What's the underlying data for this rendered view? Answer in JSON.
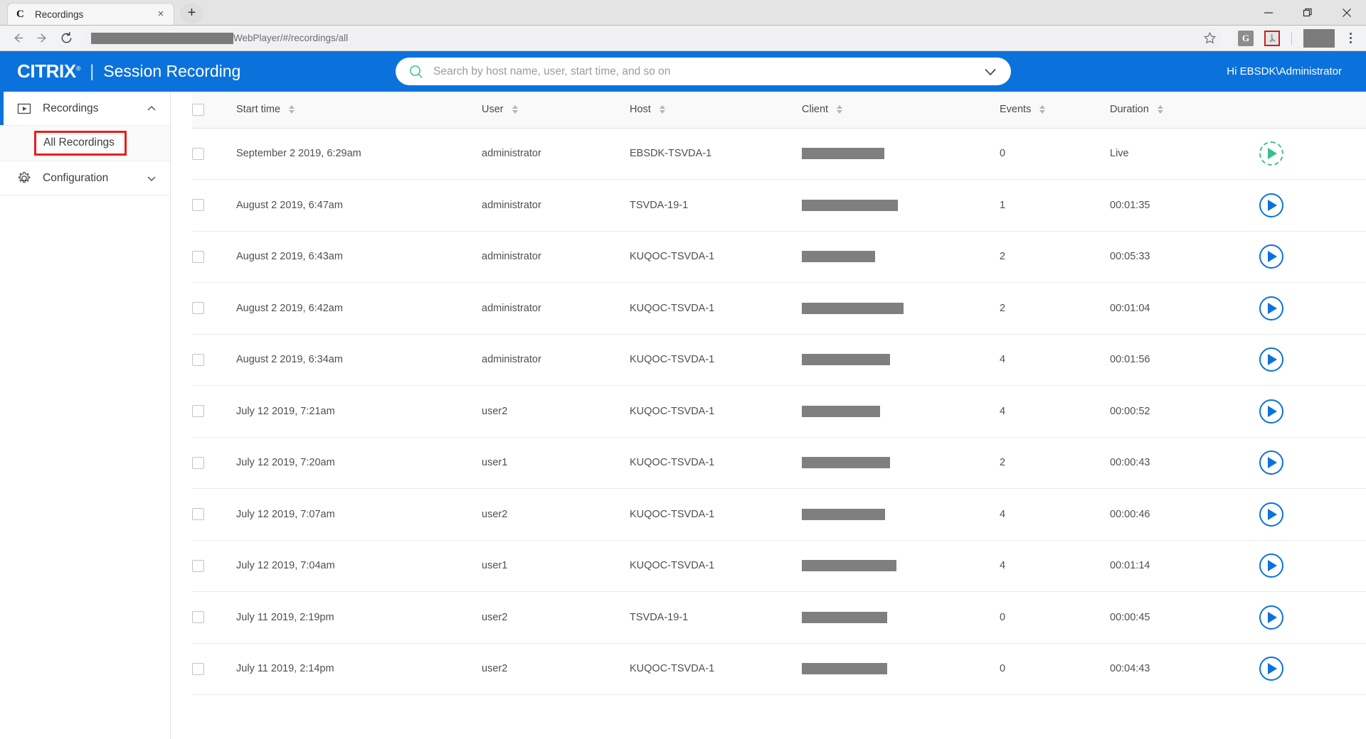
{
  "browser": {
    "tab": {
      "favicon": "C",
      "title": "Recordings",
      "close_label": "×"
    },
    "new_tab_label": "+",
    "window_controls": {
      "minimize": "minimize-icon",
      "maximize": "maximize-icon",
      "close": "close-icon"
    },
    "nav": {
      "back": "back-icon",
      "forward": "forward-icon",
      "reload": "reload-icon"
    },
    "url_text": "WebPlayer/#/recordings/all",
    "url_redacted": true,
    "toolbar_icons": [
      "star-icon",
      "google-extension-icon",
      "adobe-pdf-extension-icon",
      "profile-avatar",
      "browser-menu-icon"
    ],
    "extension_g_label": "G"
  },
  "header": {
    "brand": "CITRIX",
    "brand_trademark": "®",
    "separator": "|",
    "product": "Session Recording",
    "greeting": "Hi EBSDK\\Administrator",
    "accent_color": "#0b72dc"
  },
  "search": {
    "placeholder": "Search by host name, user, start time, and so on",
    "value": "",
    "icon": "search-icon",
    "chevron": "chevron-down-icon"
  },
  "sidebar": {
    "items": [
      {
        "label": "Recordings",
        "icon": "play-square-icon",
        "chevron": "chevron-up-icon",
        "expanded": true,
        "active": true
      },
      {
        "label": "Configuration",
        "icon": "gear-icon",
        "chevron": "chevron-down-icon",
        "expanded": false,
        "active": false
      }
    ],
    "sub_item": {
      "label": "All Recordings",
      "highlighted": true,
      "highlight_color": "#ee1c1c"
    }
  },
  "table": {
    "columns": [
      {
        "key": "start_time",
        "label": "Start time",
        "sortable": true
      },
      {
        "key": "user",
        "label": "User",
        "sortable": true
      },
      {
        "key": "host",
        "label": "Host",
        "sortable": true
      },
      {
        "key": "client",
        "label": "Client",
        "sortable": true
      },
      {
        "key": "events",
        "label": "Events",
        "sortable": true
      },
      {
        "key": "duration",
        "label": "Duration",
        "sortable": true
      }
    ],
    "rows": [
      {
        "start_time": "September 2 2019, 6:29am",
        "user": "administrator",
        "host": "EBSDK-TSVDA-1",
        "client_width": 116,
        "events": "0",
        "duration": "Live",
        "live": true
      },
      {
        "start_time": "August 2 2019, 6:47am",
        "user": "administrator",
        "host": "TSVDA-19-1",
        "client_width": 135,
        "events": "1",
        "duration": "00:01:35",
        "live": false
      },
      {
        "start_time": "August 2 2019, 6:43am",
        "user": "administrator",
        "host": "KUQOC-TSVDA-1",
        "client_width": 103,
        "events": "2",
        "duration": "00:05:33",
        "live": false
      },
      {
        "start_time": "August 2 2019, 6:42am",
        "user": "administrator",
        "host": "KUQOC-TSVDA-1",
        "client_width": 143,
        "events": "2",
        "duration": "00:01:04",
        "live": false
      },
      {
        "start_time": "August 2 2019, 6:34am",
        "user": "administrator",
        "host": "KUQOC-TSVDA-1",
        "client_width": 124,
        "events": "4",
        "duration": "00:01:56",
        "live": false
      },
      {
        "start_time": "July 12 2019, 7:21am",
        "user": "user2",
        "host": "KUQOC-TSVDA-1",
        "client_width": 110,
        "events": "4",
        "duration": "00:00:52",
        "live": false
      },
      {
        "start_time": "July 12 2019, 7:20am",
        "user": "user1",
        "host": "KUQOC-TSVDA-1",
        "client_width": 124,
        "events": "2",
        "duration": "00:00:43",
        "live": false
      },
      {
        "start_time": "July 12 2019, 7:07am",
        "user": "user2",
        "host": "KUQOC-TSVDA-1",
        "client_width": 117,
        "events": "4",
        "duration": "00:00:46",
        "live": false
      },
      {
        "start_time": "July 12 2019, 7:04am",
        "user": "user1",
        "host": "KUQOC-TSVDA-1",
        "client_width": 133,
        "events": "4",
        "duration": "00:01:14",
        "live": false
      },
      {
        "start_time": "July 11 2019, 2:19pm",
        "user": "user2",
        "host": "TSVDA-19-1",
        "client_width": 120,
        "events": "0",
        "duration": "00:00:45",
        "live": false
      },
      {
        "start_time": "July 11 2019, 2:14pm",
        "user": "user2",
        "host": "KUQOC-TSVDA-1",
        "client_width": 120,
        "events": "0",
        "duration": "00:04:43",
        "live": false
      }
    ]
  }
}
